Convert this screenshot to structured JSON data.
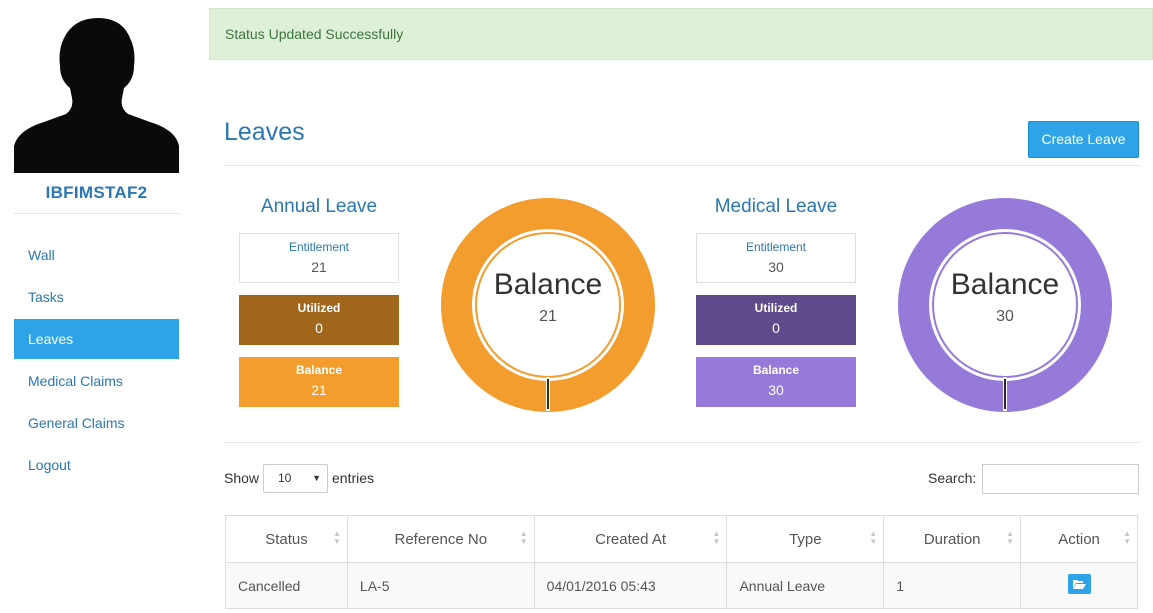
{
  "user": {
    "name": "IBFIMSTAF2"
  },
  "nav": {
    "items": [
      {
        "label": "Wall",
        "active": false
      },
      {
        "label": "Tasks",
        "active": false
      },
      {
        "label": "Leaves",
        "active": true
      },
      {
        "label": "Medical Claims",
        "active": false
      },
      {
        "label": "General Claims",
        "active": false
      },
      {
        "label": "Logout",
        "active": false
      }
    ]
  },
  "alert": {
    "message": "Status Updated Successfully",
    "color": "#dff0d8"
  },
  "page": {
    "title": "Leaves",
    "create_button": "Create Leave"
  },
  "annual": {
    "title": "Annual Leave",
    "entitlement_label": "Entitlement",
    "entitlement": "21",
    "utilized_label": "Utilized",
    "utilized": "0",
    "balance_label": "Balance",
    "balance": "21",
    "ring_label": "Balance",
    "ring_value": "21",
    "colors": {
      "utilized": "#a0661c",
      "balance": "#f29d2d",
      "ring": "#f29d2d"
    }
  },
  "medical": {
    "title": "Medical Leave",
    "entitlement_label": "Entitlement",
    "entitlement": "30",
    "utilized_label": "Utilized",
    "utilized": "0",
    "balance_label": "Balance",
    "balance": "30",
    "ring_label": "Balance",
    "ring_value": "30",
    "colors": {
      "utilized": "#5f4b8b",
      "balance": "#967ada",
      "ring": "#967ada"
    }
  },
  "table_controls": {
    "show_label": "Show",
    "page_size": "10",
    "entries_label": "entries",
    "search_label": "Search:"
  },
  "table": {
    "headers": [
      "Status",
      "Reference No",
      "Created At",
      "Type",
      "Duration",
      "Action"
    ],
    "rows": [
      {
        "status": "Cancelled",
        "reference": "LA-5",
        "created_at": "04/01/2016 05:43",
        "type": "Annual Leave",
        "duration": "1",
        "action_icon": "folder-open-icon"
      }
    ]
  }
}
